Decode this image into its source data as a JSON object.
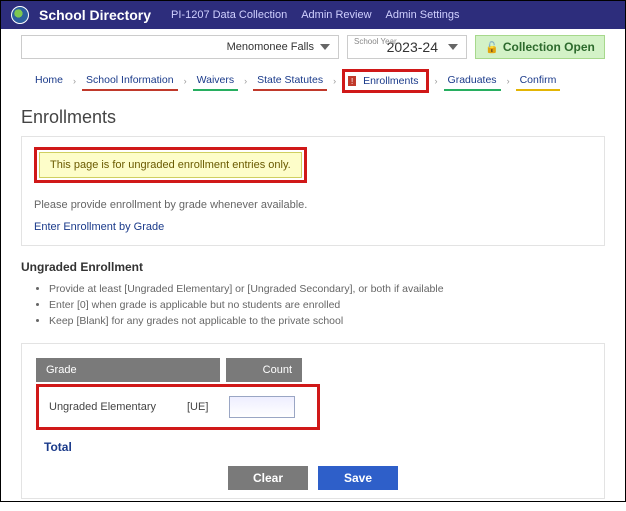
{
  "header": {
    "brand": "School Directory",
    "links": [
      "PI-1207 Data Collection",
      "Admin Review",
      "Admin Settings"
    ]
  },
  "filters": {
    "district": "Menomonee Falls",
    "year_label": "School Year",
    "year": "2023-24",
    "status": "Collection Open"
  },
  "crumbs": {
    "home": "Home",
    "school_info": "School Information",
    "waivers": "Waivers",
    "statutes": "State Statutes",
    "enrollments": "Enrollments",
    "graduates": "Graduates",
    "confirm": "Confirm"
  },
  "page": {
    "title": "Enrollments",
    "banner": "This page is for ungraded enrollment entries only.",
    "note": "Please provide enrollment by grade whenever available.",
    "link": "Enter Enrollment by Grade",
    "subheading": "Ungraded Enrollment",
    "bullets": [
      "Provide at least [Ungraded Elementary] or [Ungraded Secondary], or both if available",
      "Enter [0] when grade is applicable but no students are enrolled",
      "Keep [Blank] for any grades not applicable to the private school"
    ]
  },
  "table": {
    "col_grade": "Grade",
    "col_count": "Count",
    "rows": [
      {
        "name": "Ungraded Elementary",
        "code": "[UE]",
        "value": ""
      }
    ],
    "total_label": "Total"
  },
  "buttons": {
    "clear": "Clear",
    "save": "Save"
  }
}
